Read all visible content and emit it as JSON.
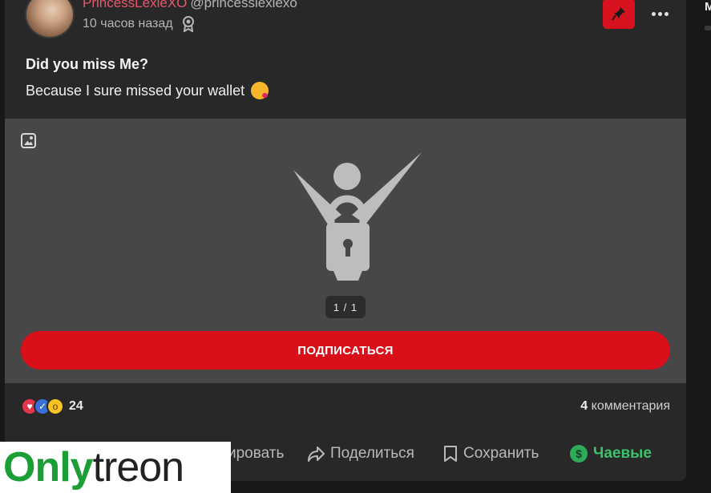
{
  "post": {
    "username": "PrincessLexieXO",
    "handle": "@princesslexiexo",
    "time": "10 часов назад",
    "title": "Did you miss Me?",
    "body": "Because I sure missed your wallet"
  },
  "media": {
    "counter": "1 / 1",
    "subscribe_label": "ПОДПИСАТЬСЯ"
  },
  "reactions": {
    "count": "24",
    "comments_count": "4",
    "comments_label": "комментария"
  },
  "actions": {
    "comment_label": "ировать",
    "share_label": "Поделиться",
    "save_label": "Сохранить",
    "tips_label": "Чаевые"
  },
  "watermark": {
    "part1": "Only",
    "part2": "treon"
  },
  "sidebar": {
    "letter": "M"
  },
  "colors": {
    "accent_red": "#d90f1a",
    "username_pink": "#e8566b",
    "tips_green": "#3cc26a",
    "card_bg": "#282828",
    "media_bg": "#474747"
  },
  "icons": [
    "award-icon",
    "pin-icon",
    "more-icon",
    "image-icon",
    "lock-icon",
    "love-reaction-icon",
    "like-reaction-icon",
    "wow-reaction-icon",
    "share-icon",
    "bookmark-icon",
    "dollar-icon"
  ]
}
